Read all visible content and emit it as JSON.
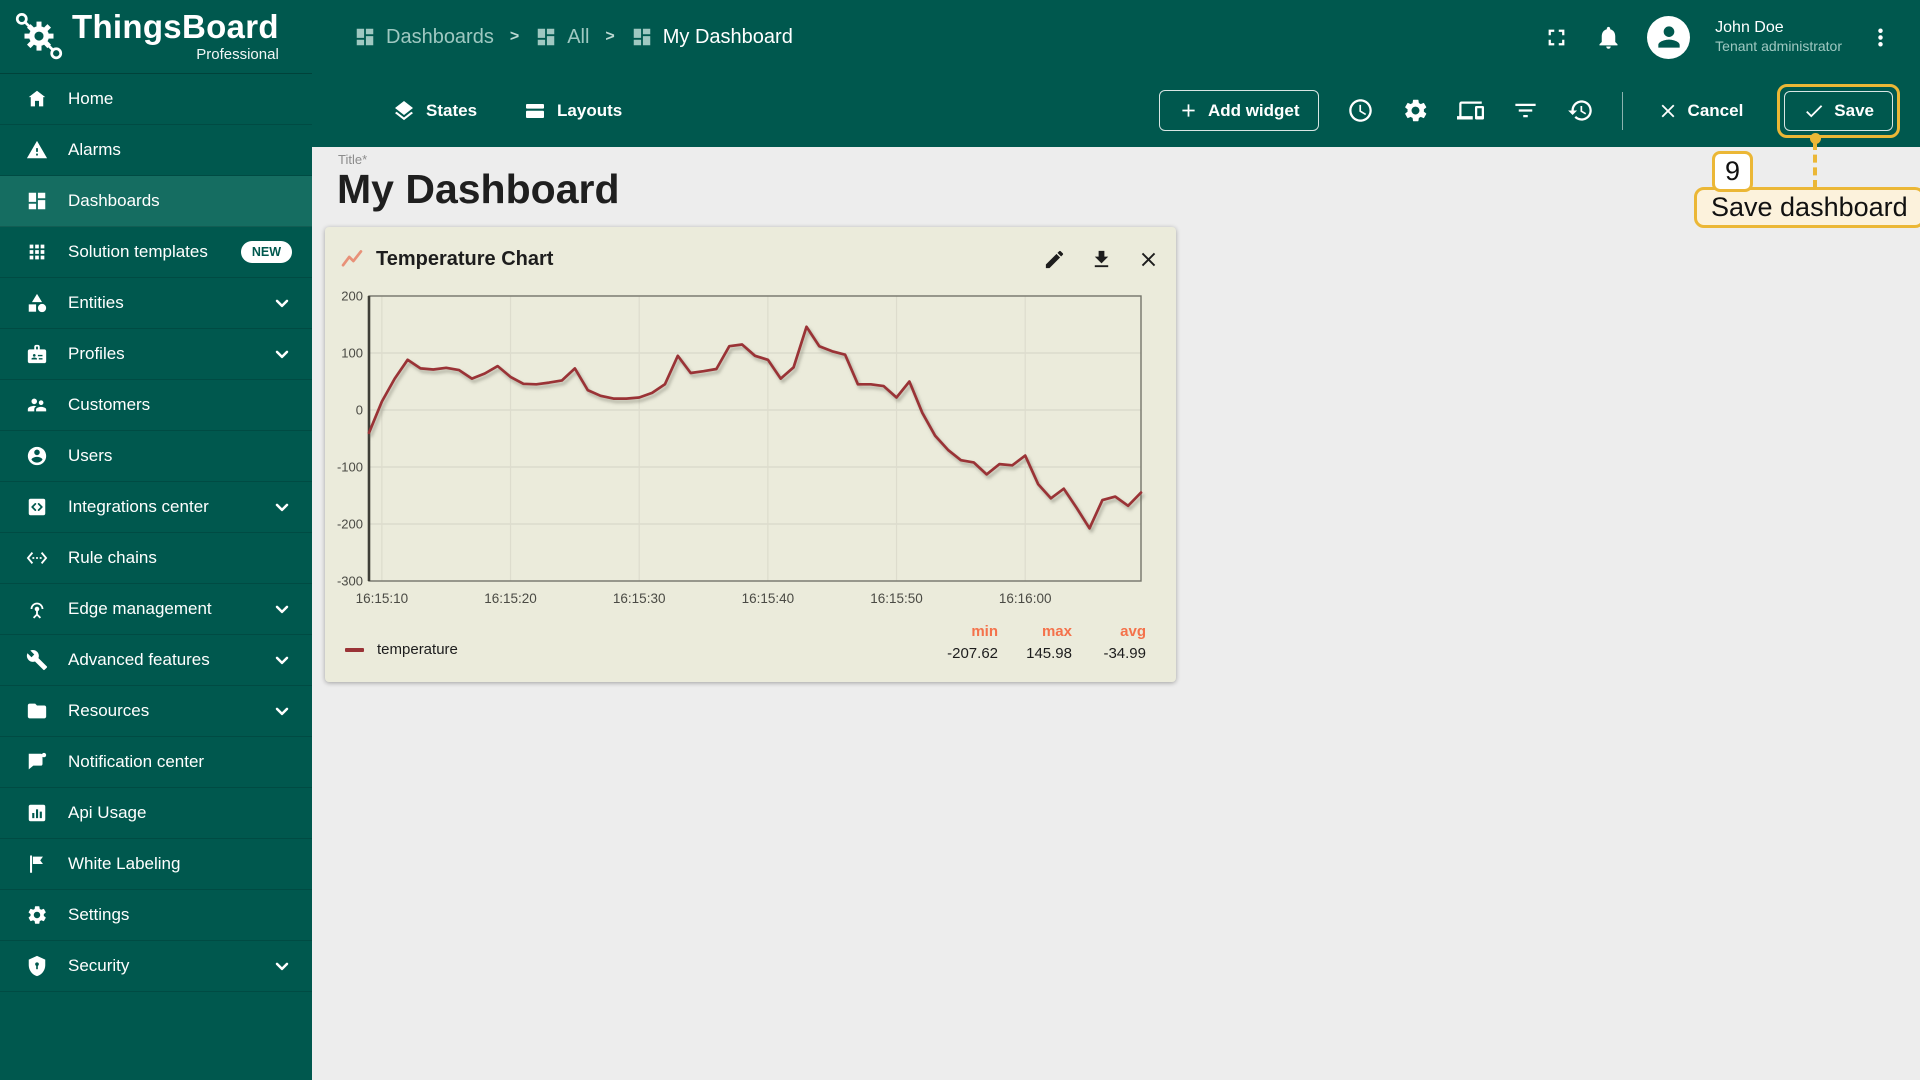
{
  "app": {
    "name": "ThingsBoard",
    "edition": "Professional"
  },
  "breadcrumb": {
    "separator": ">",
    "items": [
      {
        "label": "Dashboards"
      },
      {
        "label": "All"
      },
      {
        "label": "My Dashboard"
      }
    ]
  },
  "user": {
    "name": "John Doe",
    "role": "Tenant administrator"
  },
  "toolbar": {
    "states_label": "States",
    "layouts_label": "Layouts",
    "add_widget_label": "Add widget",
    "cancel_label": "Cancel",
    "save_label": "Save"
  },
  "sidebar": {
    "items": [
      {
        "label": "Home",
        "icon": "home-icon"
      },
      {
        "label": "Alarms",
        "icon": "warning-icon"
      },
      {
        "label": "Dashboards",
        "icon": "dashboards-icon",
        "active": true
      },
      {
        "label": "Solution templates",
        "icon": "apps-grid-icon",
        "badge": "NEW"
      },
      {
        "label": "Entities",
        "icon": "category-icon",
        "chevron": true
      },
      {
        "label": "Profiles",
        "icon": "badge-icon",
        "chevron": true
      },
      {
        "label": "Customers",
        "icon": "people-icon"
      },
      {
        "label": "Users",
        "icon": "person-icon"
      },
      {
        "label": "Integrations center",
        "icon": "integration-icon",
        "chevron": true
      },
      {
        "label": "Rule chains",
        "icon": "ethernet-icon"
      },
      {
        "label": "Edge management",
        "icon": "antenna-icon",
        "chevron": true
      },
      {
        "label": "Advanced features",
        "icon": "wrench-icon",
        "chevron": true
      },
      {
        "label": "Resources",
        "icon": "folder-icon",
        "chevron": true
      },
      {
        "label": "Notification center",
        "icon": "message-icon"
      },
      {
        "label": "Api Usage",
        "icon": "bar-chart-icon"
      },
      {
        "label": "White Labeling",
        "icon": "flag-icon"
      },
      {
        "label": "Settings",
        "icon": "gear-icon"
      },
      {
        "label": "Security",
        "icon": "shield-icon",
        "chevron": true
      }
    ]
  },
  "main": {
    "title_label": "Title*",
    "dashboard_title": "My Dashboard"
  },
  "widget": {
    "title": "Temperature Chart",
    "legend": {
      "series_label": "temperature",
      "min_label": "min",
      "max_label": "max",
      "avg_label": "avg",
      "min": "-207.62",
      "max": "145.98",
      "avg": "-34.99"
    }
  },
  "annotation": {
    "step": "9",
    "label": "Save dashboard"
  },
  "colors": {
    "header_teal": "#00584E",
    "active_item_teal": "#156D61",
    "widget_background": "#EBEBDB",
    "series_red": "#9A3336",
    "stats_orange": "#F4724B",
    "highlight_gold": "#EBB736",
    "tooltip_cream": "#FCF2DC"
  },
  "chart_data": {
    "type": "line",
    "title": "Temperature Chart",
    "x_start": "16:15:09",
    "x_interval_seconds": 1,
    "x_ticks": [
      {
        "index": 1,
        "label": "16:15:10"
      },
      {
        "index": 11,
        "label": "16:15:20"
      },
      {
        "index": 21,
        "label": "16:15:30"
      },
      {
        "index": 31,
        "label": "16:15:40"
      },
      {
        "index": 41,
        "label": "16:15:50"
      },
      {
        "index": 51,
        "label": "16:16:00"
      }
    ],
    "y_ticks": [
      200,
      100,
      0,
      -100,
      -200,
      -300
    ],
    "ylim": [
      -300,
      200
    ],
    "grid": true,
    "legend_position": "bottom",
    "series": [
      {
        "name": "temperature",
        "color": "#9A3336",
        "values": [
          -40,
          15,
          55,
          88,
          73,
          71,
          74,
          70,
          55,
          64,
          77,
          58,
          46,
          45,
          48,
          52,
          73,
          35,
          25,
          20,
          20,
          22,
          30,
          45,
          95,
          65,
          68,
          72,
          112,
          115,
          95,
          88,
          55,
          75,
          145.98,
          112,
          103,
          97,
          45,
          45,
          42,
          22,
          50,
          -5,
          -45,
          -70,
          -88,
          -92,
          -113,
          -95,
          -97,
          -80,
          -130,
          -155,
          -138,
          -172,
          -207.62,
          -158,
          -152,
          -168,
          -145
        ]
      }
    ],
    "stats": {
      "min": -207.62,
      "max": 145.98,
      "avg": -34.99
    }
  }
}
